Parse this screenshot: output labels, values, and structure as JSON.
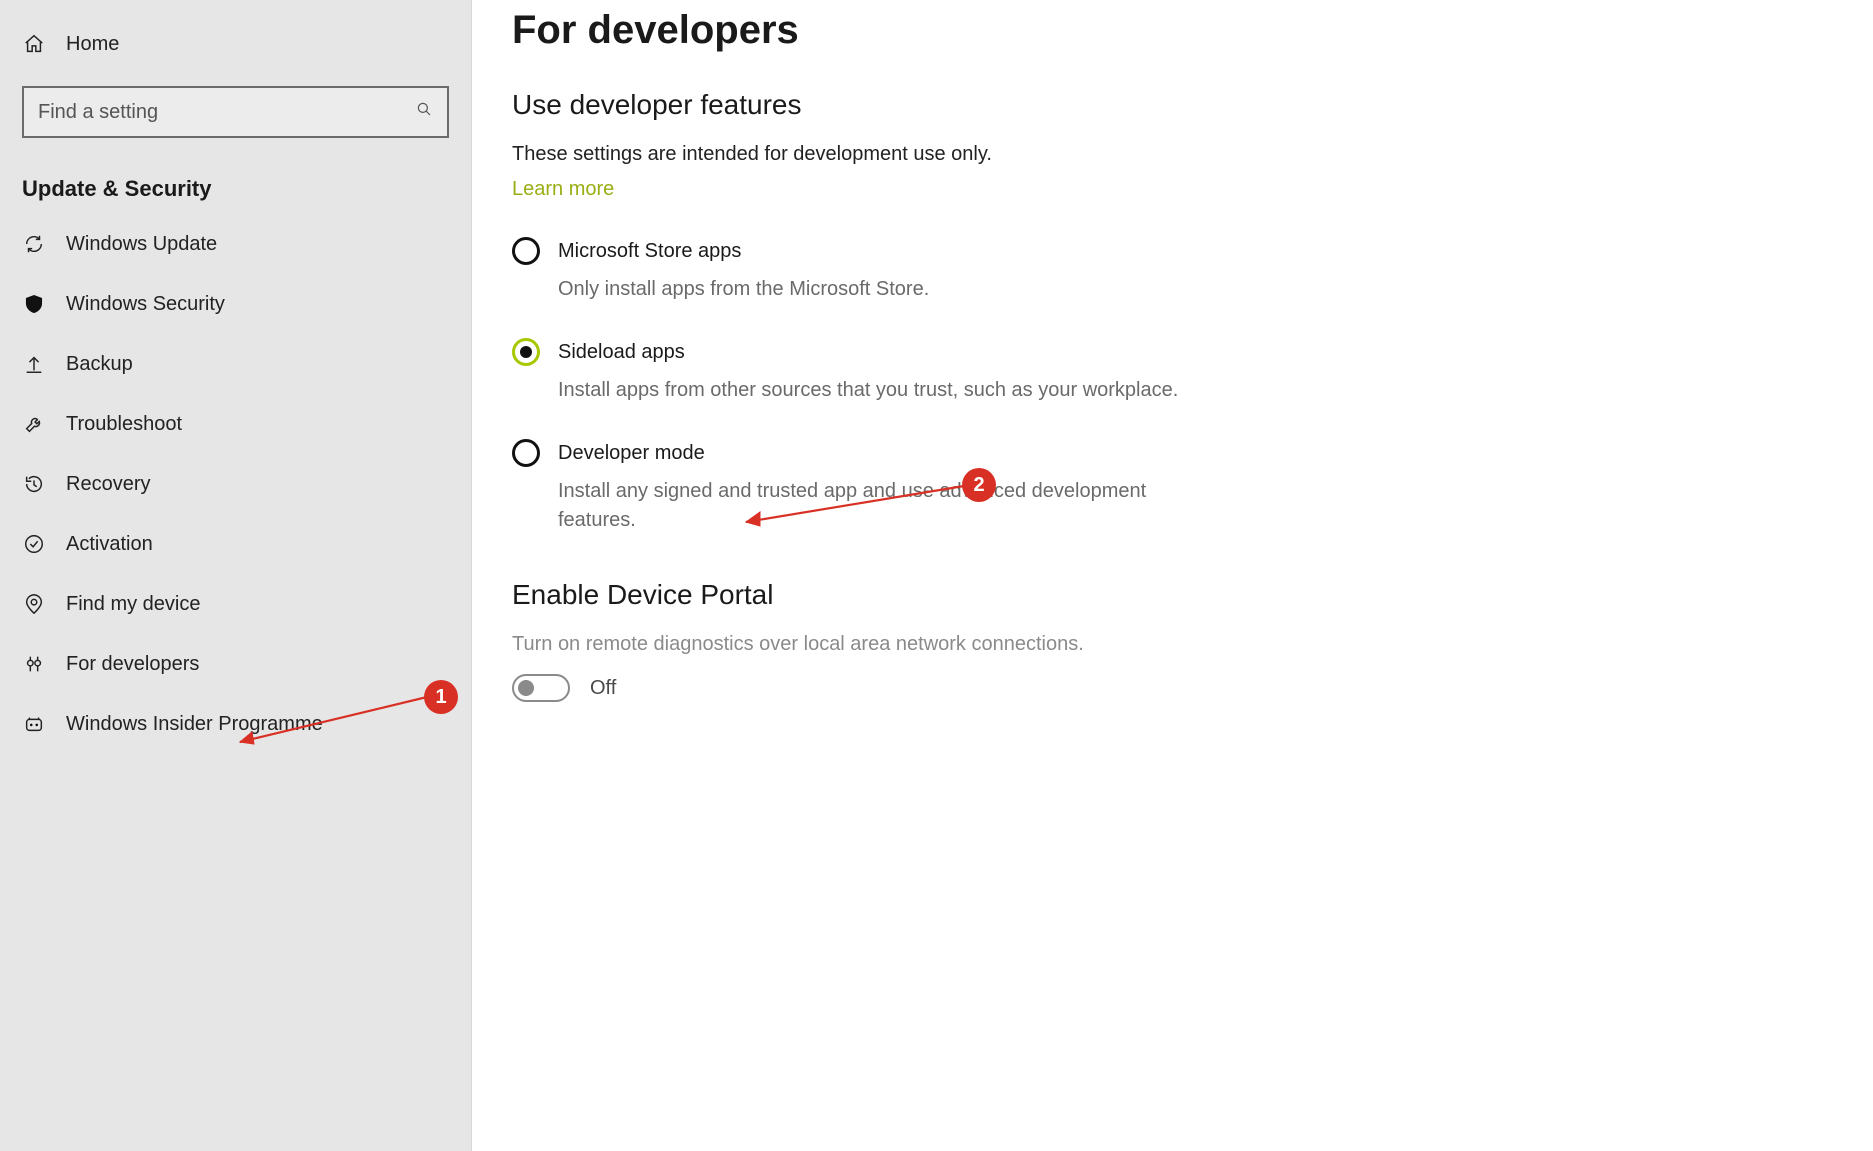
{
  "sidebar": {
    "home_label": "Home",
    "search_placeholder": "Find a setting",
    "section_title": "Update & Security",
    "items": [
      {
        "icon": "sync",
        "label": "Windows Update"
      },
      {
        "icon": "shield",
        "label": "Windows Security"
      },
      {
        "icon": "backup",
        "label": "Backup"
      },
      {
        "icon": "wrench",
        "label": "Troubleshoot"
      },
      {
        "icon": "history",
        "label": "Recovery"
      },
      {
        "icon": "check",
        "label": "Activation"
      },
      {
        "icon": "locate",
        "label": "Find my device"
      },
      {
        "icon": "devtools",
        "label": "For developers"
      },
      {
        "icon": "insider",
        "label": "Windows Insider Programme"
      }
    ]
  },
  "main": {
    "title": "For developers",
    "features": {
      "heading": "Use developer features",
      "description": "These settings are intended for development use only.",
      "learn_more": "Learn more",
      "options": [
        {
          "label": "Microsoft Store apps",
          "sub": "Only install apps from the Microsoft Store.",
          "selected": false
        },
        {
          "label": "Sideload apps",
          "sub": "Install apps from other sources that you trust, such as your workplace.",
          "selected": true
        },
        {
          "label": "Developer mode",
          "sub": "Install any signed and trusted app and use advanced development features.",
          "selected": false
        }
      ]
    },
    "device_portal": {
      "heading": "Enable Device Portal",
      "description": "Turn on remote diagnostics over local area network connections.",
      "toggle_state": "Off",
      "toggle_on": false
    }
  },
  "annotations": {
    "callout_1": "1",
    "callout_2": "2"
  }
}
